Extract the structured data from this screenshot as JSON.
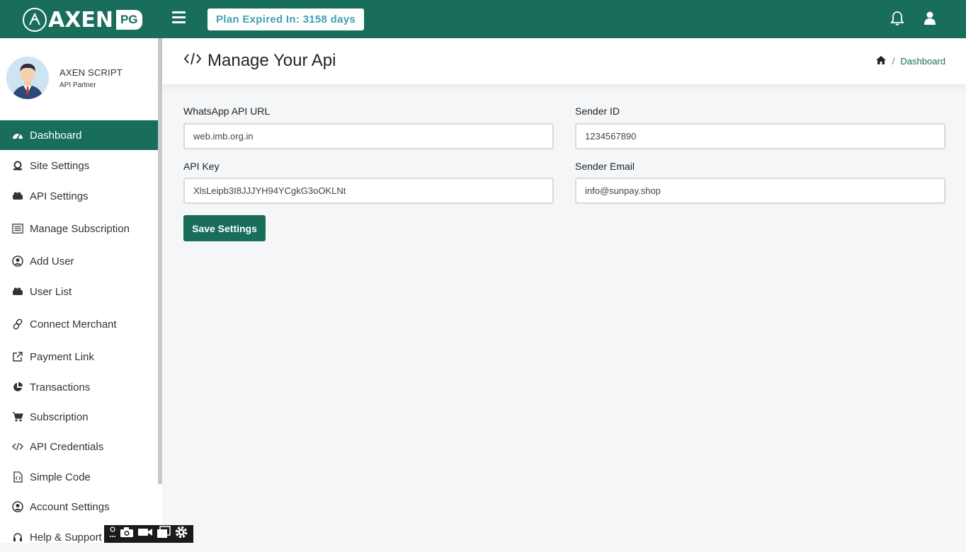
{
  "brand": {
    "logo_text": "AXEN",
    "logo_suffix": "PG"
  },
  "header": {
    "plan_badge": "Plan Expired In: 3158 days"
  },
  "profile": {
    "name": "AXEN SCRIPT",
    "role": "API Partner"
  },
  "sidebar": {
    "items": [
      {
        "label": "Dashboard",
        "icon": "dashboard-icon",
        "active": true
      },
      {
        "label": "Site Settings",
        "icon": "site-settings-icon"
      },
      {
        "label": "API Settings",
        "icon": "api-settings-icon"
      },
      {
        "label": "Manage Subscription",
        "icon": "list-icon"
      },
      {
        "label": "Add User",
        "icon": "user-circle-icon"
      },
      {
        "label": "User List",
        "icon": "users-icon"
      },
      {
        "label": "Connect Merchant",
        "icon": "link-icon"
      },
      {
        "label": "Payment Link",
        "icon": "external-link-icon"
      },
      {
        "label": "Transactions",
        "icon": "pie-chart-icon"
      },
      {
        "label": "Subscription",
        "icon": "cart-icon"
      },
      {
        "label": "API Credentials",
        "icon": "code-icon"
      },
      {
        "label": "Simple Code",
        "icon": "file-code-icon"
      },
      {
        "label": "Account Settings",
        "icon": "account-circle-icon"
      },
      {
        "label": "Help & Support",
        "icon": "headset-icon"
      }
    ]
  },
  "page": {
    "title": "Manage Your Api",
    "breadcrumb": "Dashboard"
  },
  "form": {
    "whatsapp_url": {
      "label": "WhatsApp API URL",
      "value": "web.imb.org.in"
    },
    "sender_id": {
      "label": "Sender ID",
      "value": "1234567890"
    },
    "api_key": {
      "label": "API Key",
      "value": "XlsLeipb3I8JJJYH94YCgkG3oOKLNt"
    },
    "sender_email": {
      "label": "Sender Email",
      "value": "info@sunpay.shop"
    },
    "save_label": "Save Settings"
  },
  "colors": {
    "brand": "#186e5a",
    "badge_text": "#3fa0b5"
  }
}
